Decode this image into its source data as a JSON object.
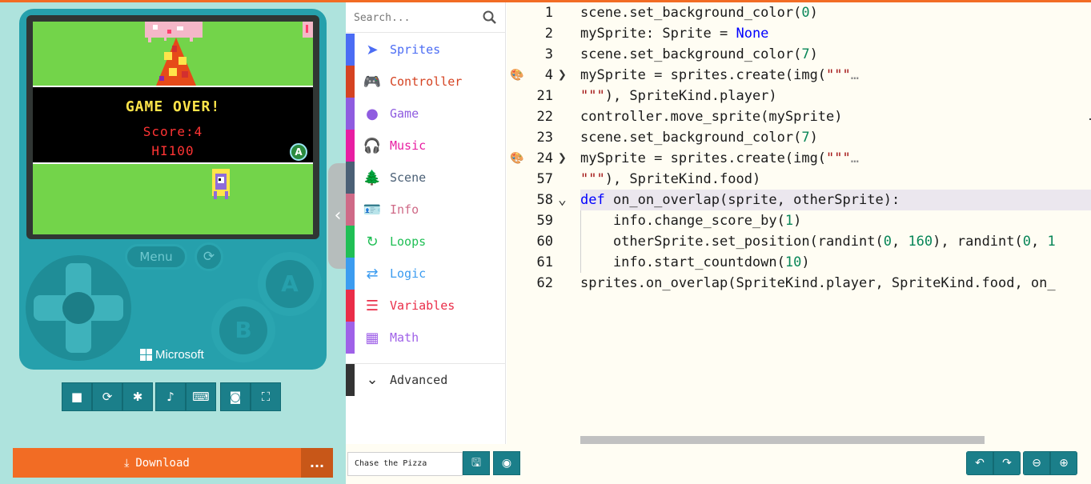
{
  "colors": {
    "accent_orange": "#f26c24",
    "console_teal": "#26a0ac",
    "sim_bg": "#aee3dd",
    "editor_bg": "#fffdf3"
  },
  "game": {
    "title": "GAME OVER!",
    "score": "Score:4",
    "hi": "HI100",
    "a_hint": "A"
  },
  "console": {
    "menu_label": "Menu",
    "btn_a": "A",
    "btn_b": "B",
    "brand": "Microsoft"
  },
  "sim_tools": [
    {
      "name": "stop-icon",
      "glyph": "■"
    },
    {
      "name": "restart-icon",
      "glyph": "⟳"
    },
    {
      "name": "debug-icon",
      "glyph": "✱"
    },
    {
      "name": "mute-icon",
      "glyph": "🔊"
    },
    {
      "name": "keyboard-icon",
      "glyph": "⌨"
    },
    {
      "name": "screenshot-icon",
      "glyph": "📷"
    },
    {
      "name": "fullscreen-icon",
      "glyph": "⛶"
    }
  ],
  "download": {
    "label": "Download",
    "more": "..."
  },
  "search": {
    "placeholder": "Search..."
  },
  "toolbox": [
    {
      "label": "Sprites",
      "color": "#4b6cf4",
      "icon": "paper-plane-icon",
      "glyph": "➤"
    },
    {
      "label": "Controller",
      "color": "#d54322",
      "icon": "gamepad-icon",
      "glyph": "🎮"
    },
    {
      "label": "Game",
      "color": "#8f5ce0",
      "icon": "circle-icon",
      "glyph": "●"
    },
    {
      "label": "Music",
      "color": "#e81ea2",
      "icon": "headphones-icon",
      "glyph": "🎧"
    },
    {
      "label": "Scene",
      "color": "#4b6076",
      "icon": "tree-icon",
      "glyph": "🌲"
    },
    {
      "label": "Info",
      "color": "#cf6a87",
      "icon": "id-card-icon",
      "glyph": "🪪"
    },
    {
      "label": "Loops",
      "color": "#20bf55",
      "icon": "loop-arrow-icon",
      "glyph": "↻"
    },
    {
      "label": "Logic",
      "color": "#3c9cf0",
      "icon": "shuffle-icon",
      "glyph": "⇄"
    },
    {
      "label": "Variables",
      "color": "#ea2d48",
      "icon": "list-icon",
      "glyph": "☰"
    },
    {
      "label": "Math",
      "color": "#9f61e8",
      "icon": "calculator-icon",
      "glyph": "▦"
    }
  ],
  "advanced": {
    "label": "Advanced"
  },
  "code": [
    {
      "ln": "1",
      "fold": "",
      "gutter": "",
      "hl": false,
      "indent": "",
      "html": "scene.set_background_color(<span class=\"t-num\">0</span>)"
    },
    {
      "ln": "2",
      "fold": "",
      "gutter": "",
      "hl": false,
      "indent": "",
      "html": "mySprite: Sprite = <span class=\"t-kw\">None</span>"
    },
    {
      "ln": "3",
      "fold": "",
      "gutter": "",
      "hl": false,
      "indent": "",
      "html": "scene.set_background_color(<span class=\"t-num\">7</span>)"
    },
    {
      "ln": "4",
      "fold": "❯",
      "gutter": "🎨",
      "hl": false,
      "indent": "",
      "html": "mySprite = sprites.create(img(<span class=\"t-str\">\"\"\"</span><span class=\"t-dots\">…</span>"
    },
    {
      "ln": "21",
      "fold": "",
      "gutter": "",
      "hl": false,
      "indent": "",
      "html": "<span class=\"t-str\">\"\"\"</span>), SpriteKind.player)"
    },
    {
      "ln": "22",
      "fold": "",
      "gutter": "",
      "hl": false,
      "indent": "",
      "html": "controller.move_sprite(mySprite)"
    },
    {
      "ln": "23",
      "fold": "",
      "gutter": "",
      "hl": false,
      "indent": "",
      "html": "scene.set_background_color(<span class=\"t-num\">7</span>)"
    },
    {
      "ln": "24",
      "fold": "❯",
      "gutter": "🎨",
      "hl": false,
      "indent": "",
      "html": "mySprite = sprites.create(img(<span class=\"t-str\">\"\"\"</span><span class=\"t-dots\">…</span>"
    },
    {
      "ln": "57",
      "fold": "",
      "gutter": "",
      "hl": false,
      "indent": "",
      "html": "<span class=\"t-str\">\"\"\"</span>), SpriteKind.food)"
    },
    {
      "ln": "58",
      "fold": "⌄",
      "gutter": "",
      "hl": true,
      "indent": "",
      "html": "<span class=\"t-kw\">def</span> on_on_overlap(sprite, otherSprite):"
    },
    {
      "ln": "59",
      "fold": "",
      "gutter": "",
      "hl": false,
      "indent": "    ",
      "html": "info.change_score_by(<span class=\"t-num\">1</span>)"
    },
    {
      "ln": "60",
      "fold": "",
      "gutter": "",
      "hl": false,
      "indent": "    ",
      "html": "otherSprite.set_position(randint(<span class=\"t-num\">0</span>, <span class=\"t-num\">160</span>), randint(<span class=\"t-num\">0</span>, <span class=\"t-num\">1</span>"
    },
    {
      "ln": "61",
      "fold": "",
      "gutter": "",
      "hl": false,
      "indent": "    ",
      "html": "info.start_countdown(<span class=\"t-num\">10</span>)"
    },
    {
      "ln": "62",
      "fold": "",
      "gutter": "",
      "hl": false,
      "indent": "",
      "html": "sprites.on_overlap(SpriteKind.player, SpriteKind.food, on_"
    }
  ],
  "bottom": {
    "project_name": "Chase the Pizza",
    "save_icon": "save-icon",
    "github_icon": "github-icon",
    "undo_icon": "undo-icon",
    "redo_icon": "redo-icon",
    "zoom_out_icon": "zoom-out-icon",
    "zoom_in_icon": "zoom-in-icon"
  }
}
